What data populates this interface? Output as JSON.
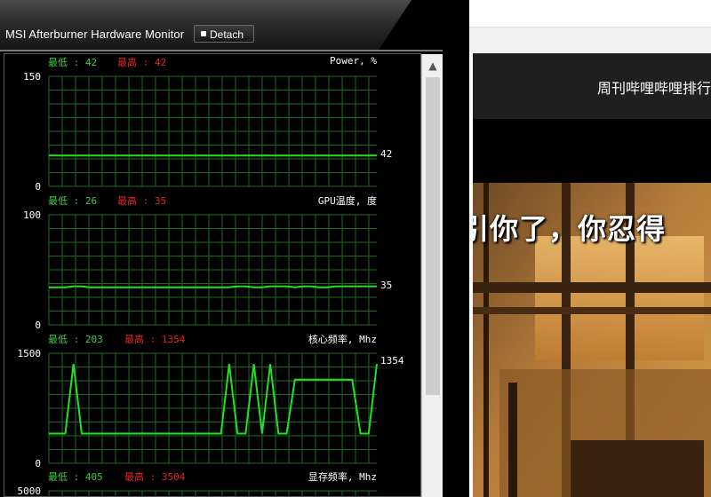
{
  "window": {
    "title": "MSI Afterburner Hardware Monitor",
    "detach_label": "Detach"
  },
  "graphs": [
    {
      "name": "Power, %",
      "min_label": "最低 : 42",
      "max_label": "最高 : 42",
      "axis_max": "150",
      "axis_min": "0",
      "current": "42",
      "min": 0,
      "max": 150,
      "values": [
        42,
        42,
        42,
        42,
        42,
        42,
        42,
        42,
        42,
        42,
        42,
        42,
        42,
        42,
        42,
        42,
        42,
        42,
        42,
        42,
        42,
        42,
        42,
        42,
        42,
        42,
        42,
        42,
        42,
        42,
        42,
        42,
        42,
        42,
        42,
        42,
        42,
        42,
        42,
        42,
        42
      ]
    },
    {
      "name": "GPU温度, 度",
      "min_label": "最低 : 26",
      "max_label": "最高 : 35",
      "axis_max": "100",
      "axis_min": "0",
      "current": "35",
      "min": 0,
      "max": 100,
      "values": [
        34,
        34,
        34,
        35,
        35,
        34,
        34,
        34,
        34,
        34,
        34,
        34,
        34,
        34,
        34,
        34,
        34,
        34,
        34,
        34,
        34,
        34,
        34,
        35,
        35,
        34,
        34,
        35,
        35,
        35,
        34,
        35,
        35,
        34,
        34,
        35,
        35,
        35,
        35,
        35,
        35
      ]
    },
    {
      "name": "核心频率, Mhz",
      "min_label": "最低 : 203",
      "max_label": "最高 : 1354",
      "axis_max": "1500",
      "axis_min": "0",
      "current": "1354",
      "min": 0,
      "max": 1500,
      "values": [
        405,
        405,
        405,
        1354,
        405,
        405,
        405,
        405,
        405,
        405,
        405,
        405,
        405,
        405,
        405,
        405,
        405,
        405,
        405,
        405,
        405,
        405,
        1354,
        405,
        405,
        1354,
        405,
        1354,
        405,
        405,
        1140,
        1140,
        1140,
        1140,
        1140,
        1140,
        1140,
        1140,
        405,
        405,
        1354
      ]
    },
    {
      "name": "显存频率, Mhz",
      "min_label": "最低 : 405",
      "max_label": "最高 : 3504",
      "axis_max": "5000",
      "axis_min": "0",
      "current": "",
      "min": 0,
      "max": 5000,
      "values": []
    }
  ],
  "browser": {
    "video_title": "周刊哔哩哔哩排行榜",
    "subtitle": "引你了，你忍得"
  },
  "colors": {
    "line": "#22e022",
    "grid": "#1f6a1f",
    "min_text": "#3ccc3c",
    "max_text": "#e52222"
  }
}
